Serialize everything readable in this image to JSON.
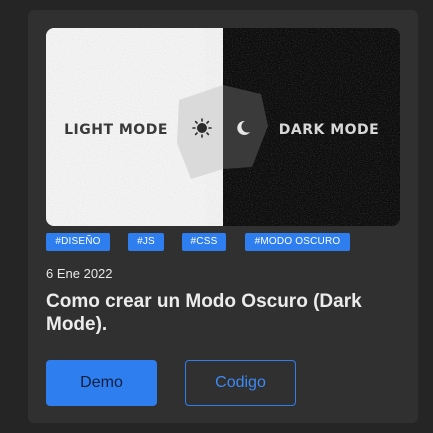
{
  "hero": {
    "light_text": "LIGHT MODE",
    "dark_text": "DARK MODE",
    "sun_icon": "sun-icon",
    "moon_icon": "moon-icon"
  },
  "tags": [
    "#DISEÑO",
    "#JS",
    "#CSS",
    "#MODO OSCURO"
  ],
  "date": "6 Ene 2022",
  "title": "Como crear un Modo Oscuro (Dark Mode).",
  "buttons": {
    "demo": "Demo",
    "code": "Codigo"
  },
  "colors": {
    "accent": "#2f7ef0",
    "background": "#252525",
    "card": "#303030"
  }
}
